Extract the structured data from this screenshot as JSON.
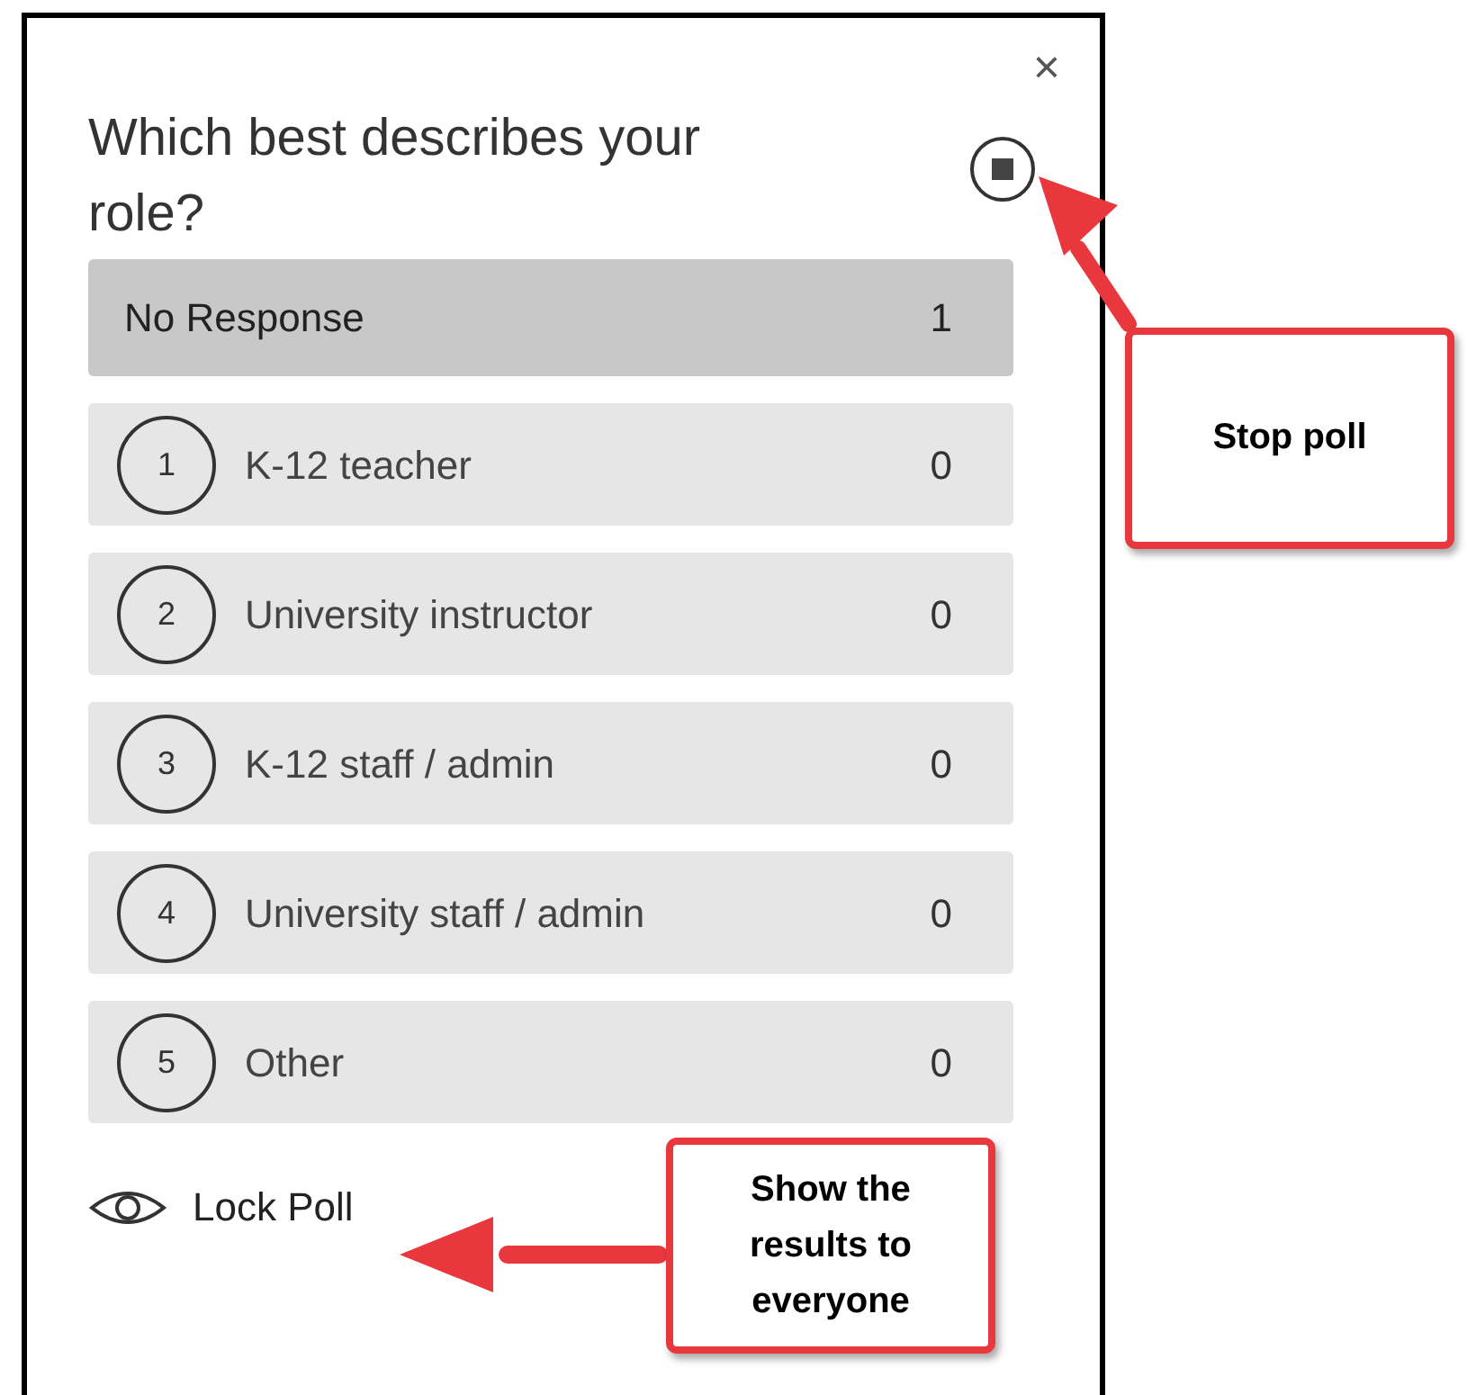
{
  "poll": {
    "close": "×",
    "question": "Which best describes your role?",
    "no_response": {
      "label": "No Response",
      "count": "1"
    },
    "options": [
      {
        "number": "1",
        "label": "K-12 teacher",
        "count": "0"
      },
      {
        "number": "2",
        "label": "University instructor",
        "count": "0"
      },
      {
        "number": "3",
        "label": "K-12 staff / admin",
        "count": "0"
      },
      {
        "number": "4",
        "label": "University staff / admin",
        "count": "0"
      },
      {
        "number": "5",
        "label": "Other",
        "count": "0"
      }
    ],
    "lock_poll": "Lock Poll"
  },
  "callouts": [
    {
      "text": "Stop poll"
    },
    {
      "text": "Show the results to everyone"
    }
  ]
}
